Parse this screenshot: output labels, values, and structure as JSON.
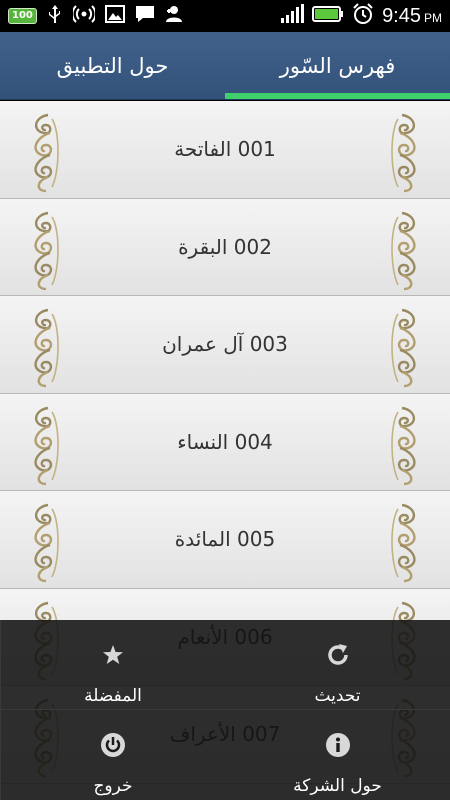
{
  "status_bar": {
    "battery_badge": "100",
    "time": "9:45",
    "ampm": "PM",
    "icons": [
      "battery-badge-icon",
      "usb-icon",
      "wireless-icon",
      "image-icon",
      "message-icon",
      "user-add-icon",
      "signal-icon",
      "battery-icon",
      "alarm-icon"
    ]
  },
  "tabs": [
    {
      "label": "فهرس السّور",
      "active": true
    },
    {
      "label": "حول التطبيق",
      "active": false
    }
  ],
  "surahs": [
    {
      "label": "001 الفاتحة"
    },
    {
      "label": "002 البقرة"
    },
    {
      "label": "003 آل عمران"
    },
    {
      "label": "004 النساء"
    },
    {
      "label": "005 المائدة"
    },
    {
      "label": "006 الأنعام"
    },
    {
      "label": "007 الأعراف"
    }
  ],
  "menu": {
    "refresh": {
      "label": "تحديث",
      "icon": "refresh-icon"
    },
    "favorites": {
      "label": "المفضلة",
      "icon": "star-icon"
    },
    "about_company": {
      "label": "حول الشركة",
      "icon": "info-icon"
    },
    "exit": {
      "label": "خروج",
      "icon": "power-icon"
    }
  },
  "colors": {
    "tab_bar": "#3a5a83",
    "active_indicator": "#3ed16b",
    "battery_green": "#57b43c"
  }
}
